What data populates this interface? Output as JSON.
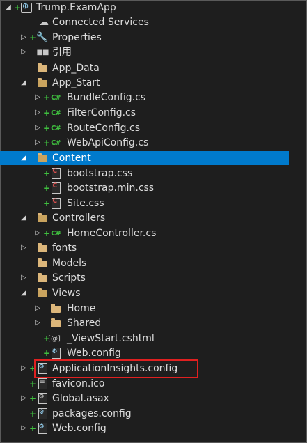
{
  "explorer": {
    "project": "Trump.ExamApp",
    "items": [
      {
        "label": "Connected Services"
      },
      {
        "label": "Properties"
      },
      {
        "label": "引用"
      },
      {
        "label": "App_Data"
      },
      {
        "label": "App_Start"
      },
      {
        "label": "BundleConfig.cs"
      },
      {
        "label": "FilterConfig.cs"
      },
      {
        "label": "RouteConfig.cs"
      },
      {
        "label": "WebApiConfig.cs"
      },
      {
        "label": "Content"
      },
      {
        "label": "bootstrap.css"
      },
      {
        "label": "bootstrap.min.css"
      },
      {
        "label": "Site.css"
      },
      {
        "label": "Controllers"
      },
      {
        "label": "HomeController.cs"
      },
      {
        "label": "fonts"
      },
      {
        "label": "Models"
      },
      {
        "label": "Scripts"
      },
      {
        "label": "Views"
      },
      {
        "label": "Home"
      },
      {
        "label": "Shared"
      },
      {
        "label": "_ViewStart.cshtml"
      },
      {
        "label": "Web.config"
      },
      {
        "label": "ApplicationInsights.config"
      },
      {
        "label": "favicon.ico"
      },
      {
        "label": "Global.asax"
      },
      {
        "label": "packages.config"
      },
      {
        "label": "Web.config"
      }
    ],
    "selected_item": "Content",
    "highlighted_item": "ApplicationInsights.config",
    "colors": {
      "background": "#1e1e1e",
      "selection": "#007acc",
      "folder": "#dcb67a",
      "added_marker": "#3fbf3f",
      "highlight_box": "#e02020"
    }
  }
}
